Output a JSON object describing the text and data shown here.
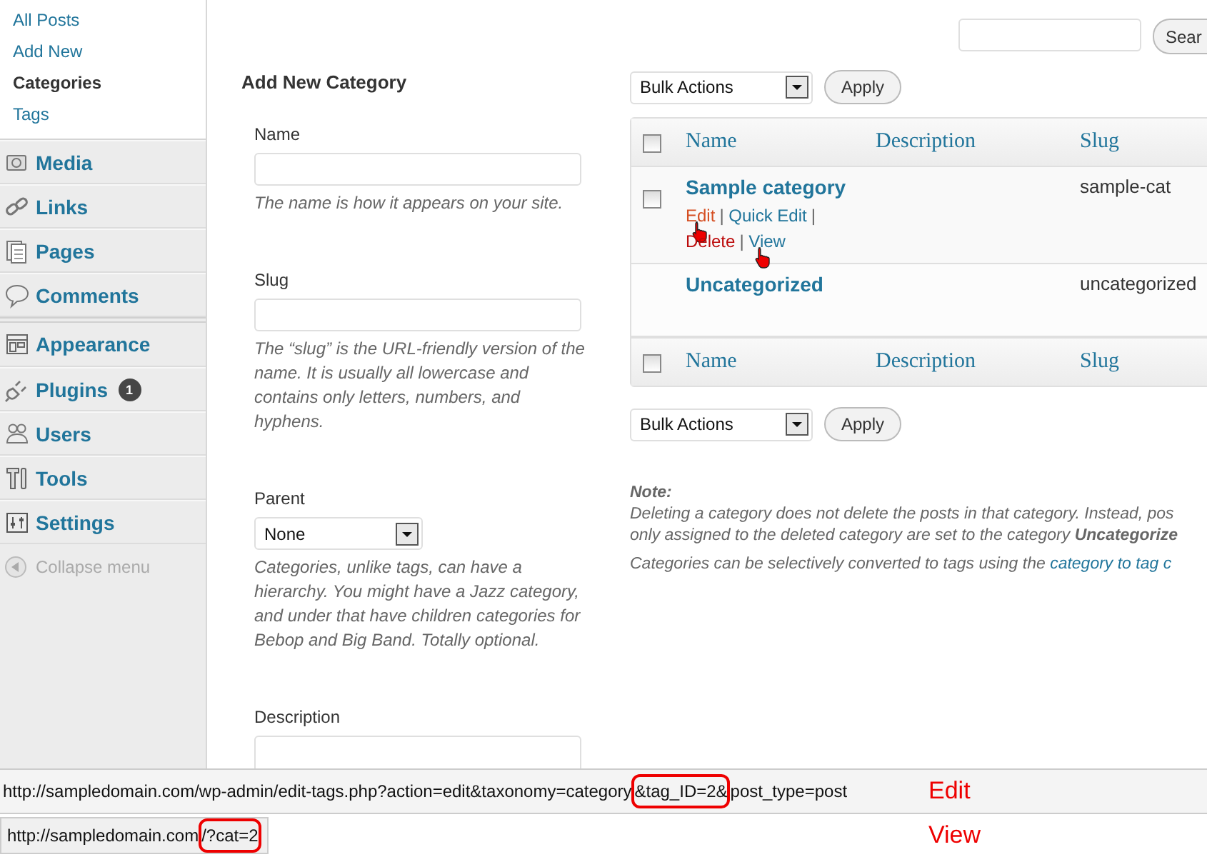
{
  "sidebar": {
    "submenu": [
      {
        "label": "All Posts",
        "selected": false
      },
      {
        "label": "Add New",
        "selected": false
      },
      {
        "label": "Categories",
        "selected": true
      },
      {
        "label": "Tags",
        "selected": false
      }
    ],
    "menu": [
      {
        "label": "Media",
        "kind": "media",
        "group_start": false
      },
      {
        "label": "Links",
        "kind": "links",
        "group_start": false
      },
      {
        "label": "Pages",
        "kind": "pages",
        "group_start": false
      },
      {
        "label": "Comments",
        "kind": "comments",
        "group_start": false
      },
      {
        "label": "Appearance",
        "kind": "appearance",
        "group_start": true
      },
      {
        "label": "Plugins",
        "kind": "plugins",
        "group_start": false,
        "badge": "1"
      },
      {
        "label": "Users",
        "kind": "users",
        "group_start": false
      },
      {
        "label": "Tools",
        "kind": "tools",
        "group_start": false
      },
      {
        "label": "Settings",
        "kind": "settings",
        "group_start": false
      }
    ],
    "collapse": "Collapse menu"
  },
  "search": {
    "button": "Sear"
  },
  "form": {
    "title": "Add New Category",
    "fields": [
      {
        "kind": "text",
        "label": "Name",
        "help": "The name is how it appears on your site."
      },
      {
        "kind": "text",
        "label": "Slug",
        "help": "The “slug” is the URL-friendly version of the name. It is usually all lowercase and contains only letters, numbers, and hyphens."
      },
      {
        "kind": "select",
        "label": "Parent",
        "value": "None",
        "help": "Categories, unlike tags, can have a hierarchy. You might have a Jazz category, and under that have children categories for Bebop and Big Band. Totally optional."
      },
      {
        "kind": "textarea",
        "label": "Description"
      }
    ]
  },
  "bulk_top": {
    "value": "Bulk Actions",
    "button": "Apply"
  },
  "table": {
    "columns": [
      "Name",
      "Description",
      "Slug"
    ],
    "footer": [
      "Name",
      "Description",
      "Slug"
    ],
    "select_all_checked": false,
    "footer_select_all_checked": false,
    "separator": "|",
    "rows": [
      {
        "name": "Sample category",
        "slug": "sample-cat",
        "has_checkbox": true,
        "checked": false,
        "actions": [
          {
            "label": "Edit",
            "kind": "edit",
            "hovered": true,
            "cursor": true
          },
          {
            "label": "Quick Edit",
            "kind": "quick",
            "hovered": false,
            "cursor": false
          },
          {
            "label": "Delete",
            "kind": "delete",
            "hovered": false,
            "cursor": false
          },
          {
            "label": "View",
            "kind": "view",
            "hovered": false,
            "cursor": true
          }
        ]
      },
      {
        "name": "Uncategorized",
        "slug": "uncategorized",
        "has_checkbox": false,
        "actions": []
      }
    ]
  },
  "bulk_bottom": {
    "value": "Bulk Actions",
    "button": "Apply"
  },
  "note": {
    "label": "Note:",
    "lines": [
      "Deleting a category does not delete the posts in that category. Instead, pos",
      "only assigned to the deleted category are set to the category **Uncategorize**"
    ],
    "tags_text": "Categories can be selectively converted to tags using the ",
    "tags_link": "category to tag c"
  },
  "status_bars": [
    {
      "before": "http://sampledomain.com/wp-admin/edit-tags.php?action=edit&taxonomy=category",
      "highlight": "&tag_ID=2&",
      "after": "post_type=post",
      "annotation": "Edit",
      "full_width": true
    },
    {
      "before": "http://sampledomain.com",
      "highlight": "/?cat=2",
      "annotation": "View",
      "full_width": false
    }
  ]
}
